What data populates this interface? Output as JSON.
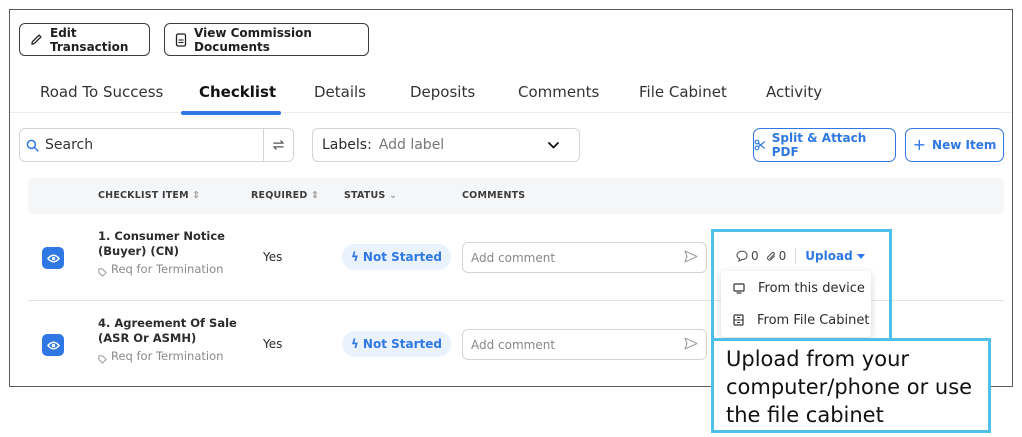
{
  "toolbar": {
    "edit_label": "Edit Transaction",
    "view_label": "View Commission Documents"
  },
  "tabs": [
    {
      "label": "Road To Success",
      "active": false
    },
    {
      "label": "Checklist",
      "active": true
    },
    {
      "label": "Details",
      "active": false
    },
    {
      "label": "Deposits",
      "active": false
    },
    {
      "label": "Comments",
      "active": false
    },
    {
      "label": "File Cabinet",
      "active": false
    },
    {
      "label": "Activity",
      "active": false
    }
  ],
  "search": {
    "value": "Search"
  },
  "labels_filter": {
    "label": "Labels:",
    "placeholder": "Add label"
  },
  "actions": {
    "split_label": "Split & Attach PDF",
    "new_label": "New Item"
  },
  "table": {
    "headers": {
      "item": "CHECKLIST ITEM",
      "required": "REQUIRED",
      "status": "STATUS",
      "comments": "COMMENTS"
    },
    "rows": [
      {
        "title": "1. Consumer Notice (Buyer) (CN)",
        "tag": "Req for Termination",
        "required": "Yes",
        "status": "Not Started",
        "comment_placeholder": "Add comment",
        "comment_count": "0",
        "attachment_count": "0",
        "upload_label": "Upload"
      },
      {
        "title": "4. Agreement Of Sale (ASR Or ASMH)",
        "tag": "Req for Termination",
        "required": "Yes",
        "status": "Not Started",
        "comment_placeholder": "Add comment"
      }
    ]
  },
  "upload_menu": {
    "items": [
      {
        "label": "From this device",
        "icon": "monitor-icon"
      },
      {
        "label": "From File Cabinet",
        "icon": "file-cabinet-icon"
      }
    ]
  },
  "callout": {
    "text": "Upload from your computer/phone or use the file cabinet"
  },
  "colors": {
    "accent": "#2f78e4",
    "highlight": "#4ec0ea",
    "status_bg": "#eaf2fd"
  }
}
